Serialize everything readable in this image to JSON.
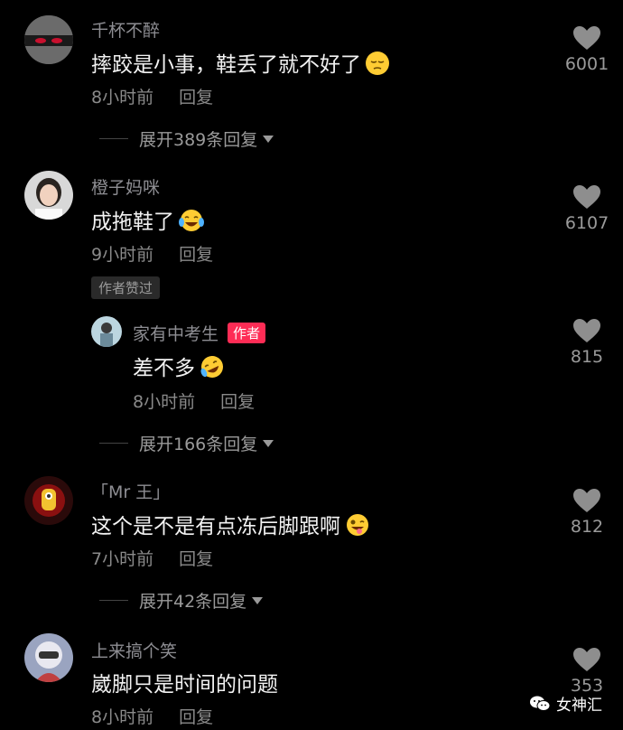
{
  "comments": [
    {
      "username": "千杯不醉",
      "text": "摔跤是小事，鞋丢了就不好了",
      "emoji": "pensive-face-emoji",
      "time": "8小时前",
      "reply_label": "回复",
      "likes": "6001",
      "expand_label": "展开389条回复"
    },
    {
      "username": "橙子妈咪",
      "text": "成拖鞋了",
      "emoji": "tears-of-joy-emoji",
      "time": "9小时前",
      "reply_label": "回复",
      "likes": "6107",
      "author_liked_badge": "作者赞过",
      "reply": {
        "username": "家有中考生",
        "author_badge": "作者",
        "text": "差不多",
        "emoji": "rolling-laughing-emoji",
        "time": "8小时前",
        "reply_label": "回复",
        "likes": "815"
      },
      "expand_label": "展开166条回复"
    },
    {
      "username": "「Mr 王」",
      "text": "这个是不是有点冻后脚跟啊",
      "emoji": "zany-face-emoji",
      "time": "7小时前",
      "reply_label": "回复",
      "likes": "812",
      "expand_label": "展开42条回复"
    },
    {
      "username": "上来搞个笑",
      "text": "崴脚只是时间的问题",
      "time": "8小时前",
      "reply_label": "回复",
      "likes": "353"
    }
  ],
  "watermark": {
    "icon": "wechat-icon",
    "label": "女神汇"
  },
  "colors": {
    "background": "#000000",
    "author_badge": "#fe2c55"
  }
}
